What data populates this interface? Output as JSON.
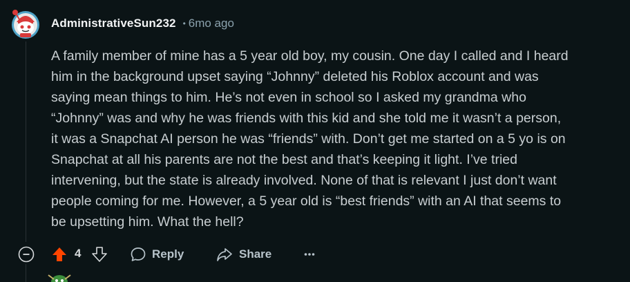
{
  "comment": {
    "username": "AdministrativeSun232",
    "separator": "•",
    "timestamp": "6mo ago",
    "body_lines": [
      "A family member of mine has a 5 year old boy, my cousin. One day I called and I heard",
      "him in the background upset saying “Johnny” deleted his Roblox account and was",
      "saying mean things to him. He’s not even in school so I asked my grandma who",
      "“Johnny” was and why he was friends with this kid and she told me it wasn’t a person,",
      "it was a Snapchat AI person he was “friends” with. Don’t get me started on a 5 yo is on",
      "Snapchat at all his parents are not the best and that’s keeping it light. I’ve tried",
      "intervening, but the state is already involved. None of that is relevant I just don’t want",
      "people coming for me. However, a 5 year old is “best friends” with an AI that seems to",
      "be upsetting him. What the hell?"
    ]
  },
  "actions": {
    "collapse_icon": "minus-circle-icon",
    "upvote_icon": "upvote-arrow-icon",
    "vote_count": "4",
    "downvote_icon": "downvote-arrow-icon",
    "reply_label": "Reply",
    "reply_icon": "speech-bubble-icon",
    "share_label": "Share",
    "share_icon": "share-arrow-icon",
    "more_label": "···",
    "more_icon": "ellipsis-icon"
  },
  "colors": {
    "background": "#0b1416",
    "upvote_active": "#ff4500",
    "text_primary": "#f2f4f5",
    "text_secondary": "#8ba2ad"
  }
}
